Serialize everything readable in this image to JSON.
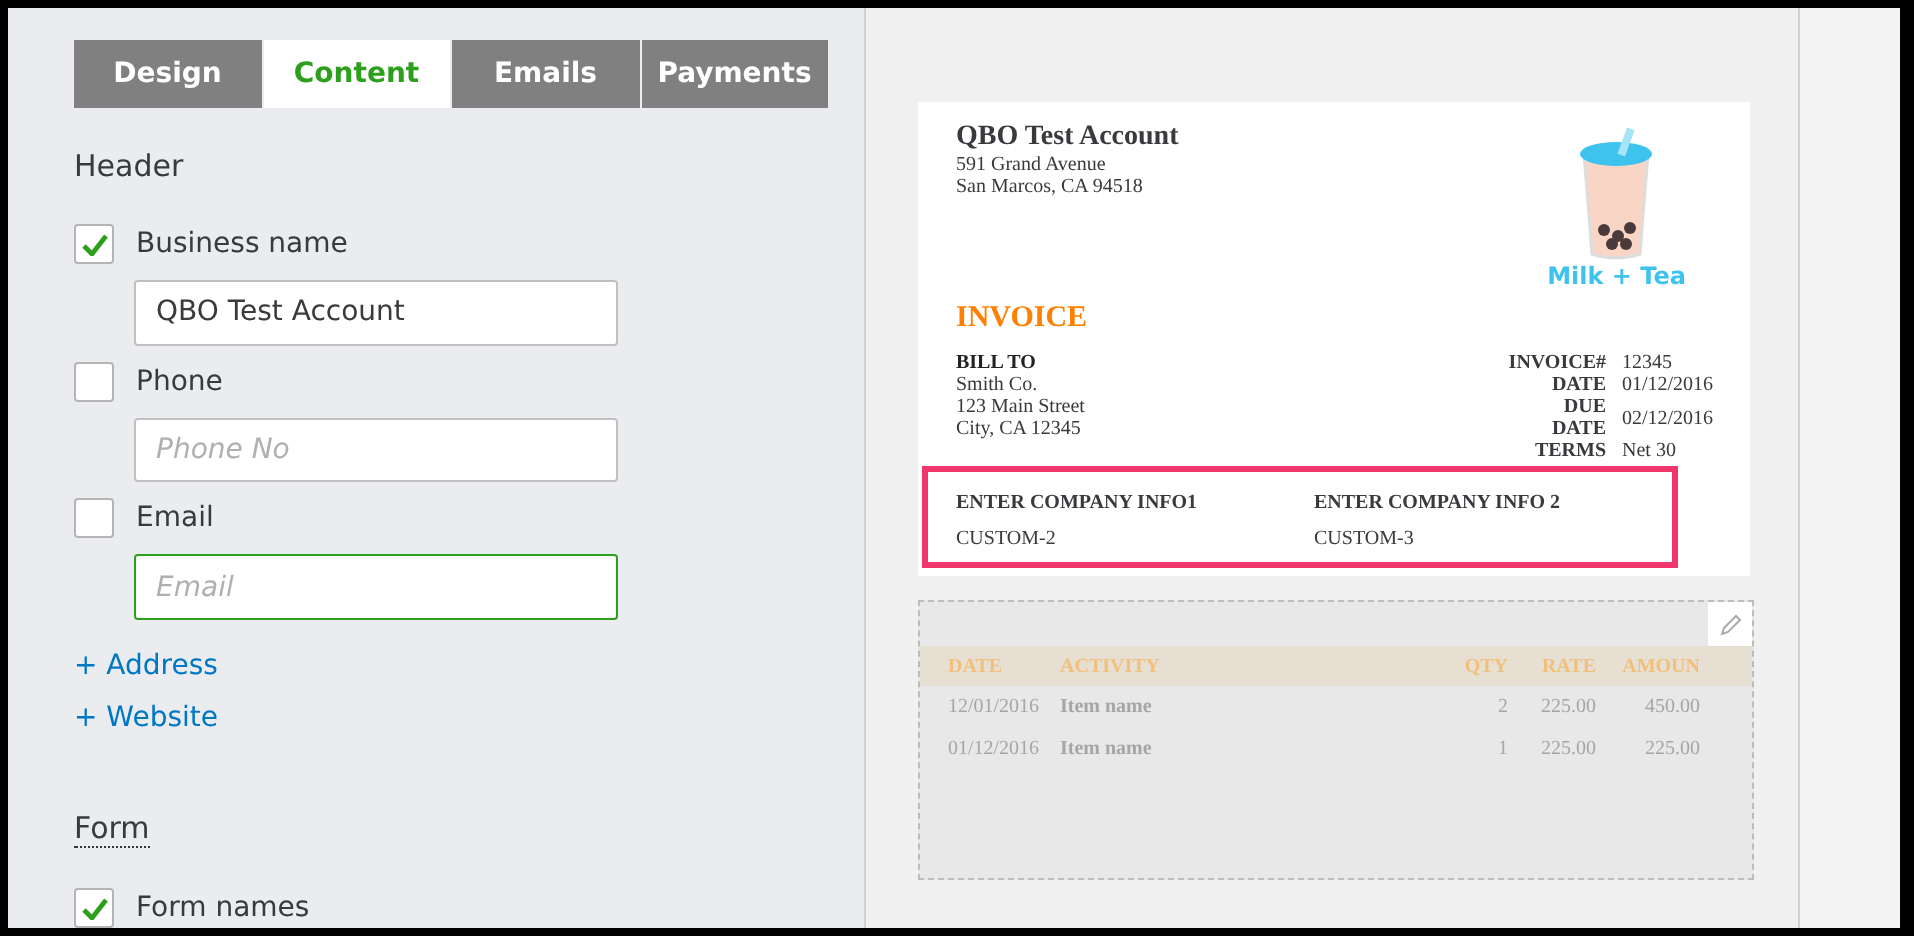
{
  "tabs": [
    {
      "label": "Design",
      "selected": false
    },
    {
      "label": "Content",
      "selected": true
    },
    {
      "label": "Emails",
      "selected": false
    },
    {
      "label": "Payments",
      "selected": false
    }
  ],
  "header_section": {
    "title": "Header",
    "fields": [
      {
        "label": "Business name",
        "checked": true,
        "value": "QBO Test Account",
        "focused": false
      },
      {
        "label": "Phone",
        "checked": false,
        "placeholder": "Phone No",
        "focused": false
      },
      {
        "label": "Email",
        "checked": false,
        "placeholder": "Email",
        "focused": true
      }
    ],
    "links": [
      "+ Address",
      "+ Website"
    ]
  },
  "form_section": {
    "title": "Form",
    "options": [
      {
        "label": "Form names",
        "checked": true
      }
    ]
  },
  "preview": {
    "company": {
      "name": "QBO Test Account",
      "address": [
        "591 Grand Avenue",
        "San Marcos, CA 94518"
      ]
    },
    "logo_text": "Milk + Tea",
    "doc_title": "INVOICE",
    "bill_to": {
      "title": "BILL TO",
      "lines": [
        "Smith Co.",
        "123 Main Street",
        "City, CA 12345"
      ]
    },
    "meta": [
      {
        "label": "INVOICE#",
        "value": "12345"
      },
      {
        "label": "DATE",
        "value": "01/12/2016"
      },
      {
        "label": "DUE DATE",
        "value": "02/12/2016"
      },
      {
        "label": "TERMS",
        "value": "Net 30"
      }
    ],
    "custom_fields": [
      {
        "title": "ENTER COMPANY INFO1",
        "value": "CUSTOM-2"
      },
      {
        "title": "ENTER COMPANY INFO 2",
        "value": "CUSTOM-3"
      }
    ],
    "table": {
      "columns": [
        "DATE",
        "ACTIVITY",
        "QTY",
        "RATE",
        "AMOUN"
      ],
      "rows": [
        [
          "12/01/2016",
          "Item name",
          "2",
          "225.00",
          "450.00"
        ],
        [
          "01/12/2016",
          "Item name",
          "1",
          "225.00",
          "225.00"
        ]
      ]
    }
  }
}
